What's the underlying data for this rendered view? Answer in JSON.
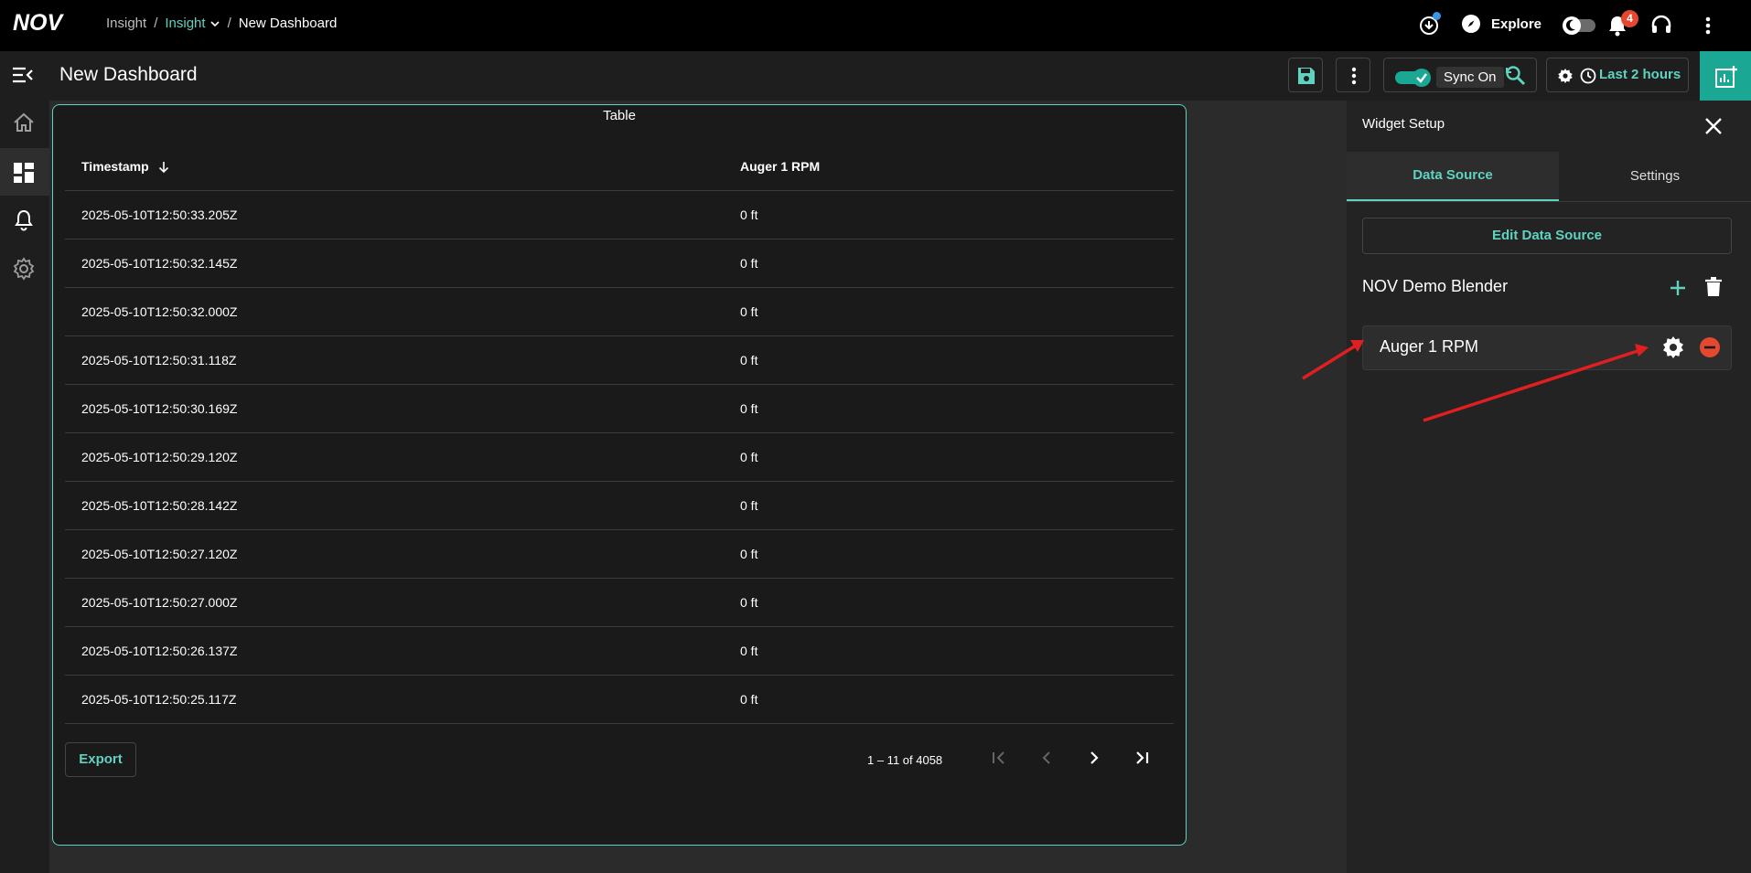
{
  "header": {
    "brand": "NOV",
    "breadcrumb": [
      "Insight",
      "Insight",
      "New Dashboard"
    ],
    "explore_label": "Explore",
    "notification_count": "4"
  },
  "toolbar": {
    "page_title": "New Dashboard",
    "sync_label": "Sync On",
    "time_range_label": "Last 2 hours"
  },
  "widget": {
    "title": "Table",
    "columns": [
      "Timestamp",
      "Auger 1 RPM"
    ],
    "rows": [
      [
        "2025-05-10T12:50:33.205Z",
        "0 ft"
      ],
      [
        "2025-05-10T12:50:32.145Z",
        "0 ft"
      ],
      [
        "2025-05-10T12:50:32.000Z",
        "0 ft"
      ],
      [
        "2025-05-10T12:50:31.118Z",
        "0 ft"
      ],
      [
        "2025-05-10T12:50:30.169Z",
        "0 ft"
      ],
      [
        "2025-05-10T12:50:29.120Z",
        "0 ft"
      ],
      [
        "2025-05-10T12:50:28.142Z",
        "0 ft"
      ],
      [
        "2025-05-10T12:50:27.120Z",
        "0 ft"
      ],
      [
        "2025-05-10T12:50:27.000Z",
        "0 ft"
      ],
      [
        "2025-05-10T12:50:26.137Z",
        "0 ft"
      ],
      [
        "2025-05-10T12:50:25.117Z",
        "0 ft"
      ]
    ],
    "export_label": "Export",
    "pagination_text": "1 – 11 of 4058"
  },
  "panel": {
    "title": "Widget Setup",
    "tabs": [
      "Data Source",
      "Settings"
    ],
    "active_tab": "Data Source",
    "edit_button_label": "Edit Data Source",
    "source_name": "NOV Demo Blender",
    "items": [
      "Auger 1 RPM"
    ]
  },
  "colors": {
    "accent": "#5fd3bf",
    "badge": "#e4482e",
    "remove": "#e4482e",
    "annotation_arrow": "#e02020"
  }
}
